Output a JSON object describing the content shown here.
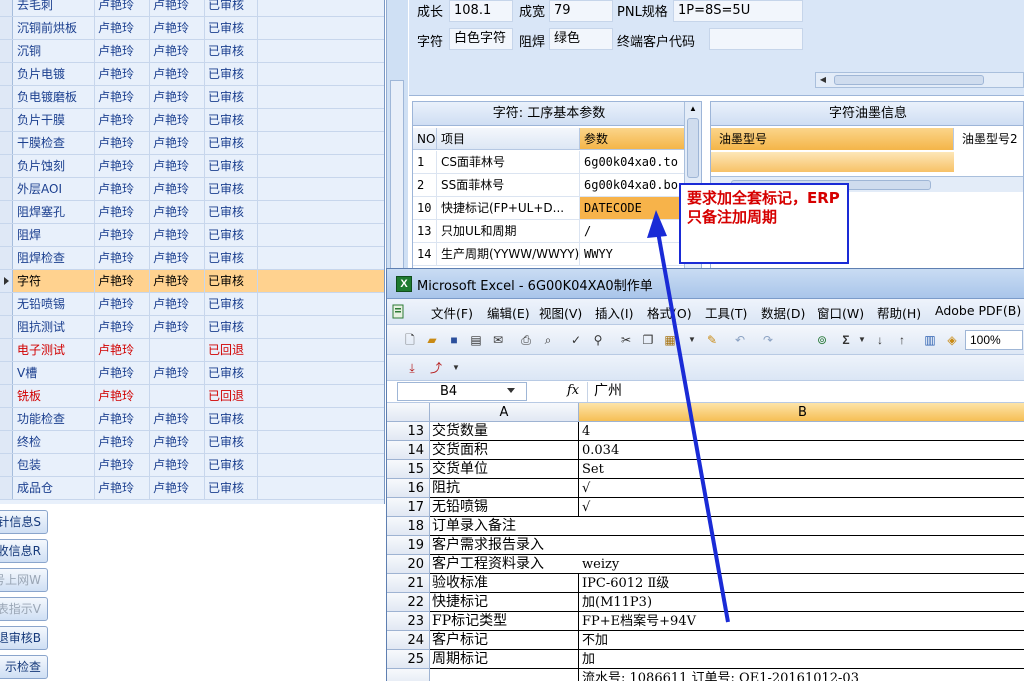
{
  "process_list": {
    "rows": [
      {
        "name": "去毛刺",
        "c1": "卢艳玲",
        "c2": "卢艳玲",
        "status": "已审核",
        "red": false,
        "selected": false
      },
      {
        "name": "沉铜前烘板",
        "c1": "卢艳玲",
        "c2": "卢艳玲",
        "status": "已审核",
        "red": false,
        "selected": false
      },
      {
        "name": "沉铜",
        "c1": "卢艳玲",
        "c2": "卢艳玲",
        "status": "已审核",
        "red": false,
        "selected": false
      },
      {
        "name": "负片电镀",
        "c1": "卢艳玲",
        "c2": "卢艳玲",
        "status": "已审核",
        "red": false,
        "selected": false
      },
      {
        "name": "负电镀磨板",
        "c1": "卢艳玲",
        "c2": "卢艳玲",
        "status": "已审核",
        "red": false,
        "selected": false
      },
      {
        "name": "负片干膜",
        "c1": "卢艳玲",
        "c2": "卢艳玲",
        "status": "已审核",
        "red": false,
        "selected": false
      },
      {
        "name": "干膜检查",
        "c1": "卢艳玲",
        "c2": "卢艳玲",
        "status": "已审核",
        "red": false,
        "selected": false
      },
      {
        "name": "负片蚀刻",
        "c1": "卢艳玲",
        "c2": "卢艳玲",
        "status": "已审核",
        "red": false,
        "selected": false
      },
      {
        "name": "外层AOI",
        "c1": "卢艳玲",
        "c2": "卢艳玲",
        "status": "已审核",
        "red": false,
        "selected": false
      },
      {
        "name": "阻焊塞孔",
        "c1": "卢艳玲",
        "c2": "卢艳玲",
        "status": "已审核",
        "red": false,
        "selected": false
      },
      {
        "name": "阻焊",
        "c1": "卢艳玲",
        "c2": "卢艳玲",
        "status": "已审核",
        "red": false,
        "selected": false
      },
      {
        "name": "阻焊检查",
        "c1": "卢艳玲",
        "c2": "卢艳玲",
        "status": "已审核",
        "red": false,
        "selected": false
      },
      {
        "name": "字符",
        "c1": "卢艳玲",
        "c2": "卢艳玲",
        "status": "已审核",
        "red": false,
        "selected": true
      },
      {
        "name": "无铅喷锡",
        "c1": "卢艳玲",
        "c2": "卢艳玲",
        "status": "已审核",
        "red": false,
        "selected": false
      },
      {
        "name": "阻抗测试",
        "c1": "卢艳玲",
        "c2": "卢艳玲",
        "status": "已审核",
        "red": false,
        "selected": false
      },
      {
        "name": "电子测试",
        "c1": "卢艳玲",
        "c2": "",
        "status": "已回退",
        "red": true,
        "selected": false
      },
      {
        "name": "V槽",
        "c1": "卢艳玲",
        "c2": "卢艳玲",
        "status": "已审核",
        "red": false,
        "selected": false
      },
      {
        "name": "铣板",
        "c1": "卢艳玲",
        "c2": "",
        "status": "已回退",
        "red": true,
        "selected": false
      },
      {
        "name": "功能检查",
        "c1": "卢艳玲",
        "c2": "卢艳玲",
        "status": "已审核",
        "red": false,
        "selected": false
      },
      {
        "name": "终检",
        "c1": "卢艳玲",
        "c2": "卢艳玲",
        "status": "已审核",
        "red": false,
        "selected": false
      },
      {
        "name": "包装",
        "c1": "卢艳玲",
        "c2": "卢艳玲",
        "status": "已审核",
        "red": false,
        "selected": false
      },
      {
        "name": "成品仓",
        "c1": "卢艳玲",
        "c2": "卢艳玲",
        "status": "已审核",
        "red": false,
        "selected": false
      }
    ]
  },
  "side_buttons": [
    {
      "label": "针信息S",
      "disabled": false
    },
    {
      "label": "收信息R",
      "disabled": false
    },
    {
      "label": "号上网W",
      "disabled": true
    },
    {
      "label": "表指示V",
      "disabled": true
    },
    {
      "label": "退审核B",
      "disabled": false
    },
    {
      "label": "示检查",
      "disabled": false
    }
  ],
  "board_info": {
    "length_label": "成长",
    "length_value": "108.1",
    "width_label": "成宽",
    "width_value": "79",
    "pnl_label": "PNL规格",
    "pnl_value": "1P=8S=5U",
    "char_label": "字符",
    "char_value": "白色字符",
    "mask_label": "阻焊",
    "mask_value": "绿色",
    "customer_code_label": "终端客户代码",
    "customer_code_value": ""
  },
  "param_panel": {
    "title": "字符: 工序基本参数",
    "headers": {
      "no": "NO",
      "item": "项目",
      "param": "参数"
    },
    "rows": [
      {
        "no": "1",
        "item": "CS面菲林号",
        "value": "6g00k04xa0.to",
        "selected": false
      },
      {
        "no": "2",
        "item": "SS面菲林号",
        "value": "6g00k04xa0.bo",
        "selected": false
      },
      {
        "no": "10",
        "item": "快捷标记(FP+UL+D...",
        "value": "DATECODE",
        "selected": true
      },
      {
        "no": "13",
        "item": "只加UL和周期",
        "value": "/",
        "selected": false
      },
      {
        "no": "14",
        "item": "生产周期(YYWW/WWYY)",
        "value": "WWYY",
        "selected": false
      }
    ]
  },
  "ink_panel": {
    "title": "字符油墨信息",
    "headers": [
      "油墨型号",
      "油墨型号2"
    ]
  },
  "annotation": {
    "text": "要求加全套标记，ERP只备注加周期",
    "color": "#d60000",
    "arrow_color": "#1a2bd6"
  },
  "excel": {
    "title": "Microsoft Excel - 6G00K04XA0制作单",
    "menu": [
      "文件(F)",
      "编辑(E)",
      "视图(V)",
      "插入(I)",
      "格式(O)",
      "工具(T)",
      "数据(D)",
      "窗口(W)",
      "帮助(H)",
      "Adobe PDF(B)"
    ],
    "zoom": "100%",
    "namebox": "B4",
    "fx": "fx",
    "formula_value": "广州",
    "columns": [
      "A",
      "B"
    ],
    "rows": [
      {
        "num": "13",
        "a": "交货数量",
        "b": "4"
      },
      {
        "num": "14",
        "a": "交货面积",
        "b": "0.034"
      },
      {
        "num": "15",
        "a": "交货单位",
        "b": "Set"
      },
      {
        "num": "16",
        "a": "阻抗",
        "b": "√"
      },
      {
        "num": "17",
        "a": "无铅喷锡",
        "b": "√"
      },
      {
        "num": "18",
        "a": "订单录入备注",
        "b": ""
      },
      {
        "num": "19",
        "a": "客户需求报告录入",
        "b": ""
      },
      {
        "num": "20",
        "a": "客户工程资料录入",
        "b": "weizy"
      },
      {
        "num": "21",
        "a": "验收标准",
        "b": "IPC-6012 Ⅱ级"
      },
      {
        "num": "22",
        "a": "快捷标记",
        "b": "加(M11P3)"
      },
      {
        "num": "23",
        "a": "FP标记类型",
        "b": "FP+E档案号+94V"
      },
      {
        "num": "24",
        "a": "客户标记",
        "b": "不加"
      },
      {
        "num": "25",
        "a": "周期标记",
        "b": "加"
      },
      {
        "num": "",
        "a": "",
        "b": "流水号: 1086611  订单号: QE1-20161012-03"
      }
    ]
  }
}
